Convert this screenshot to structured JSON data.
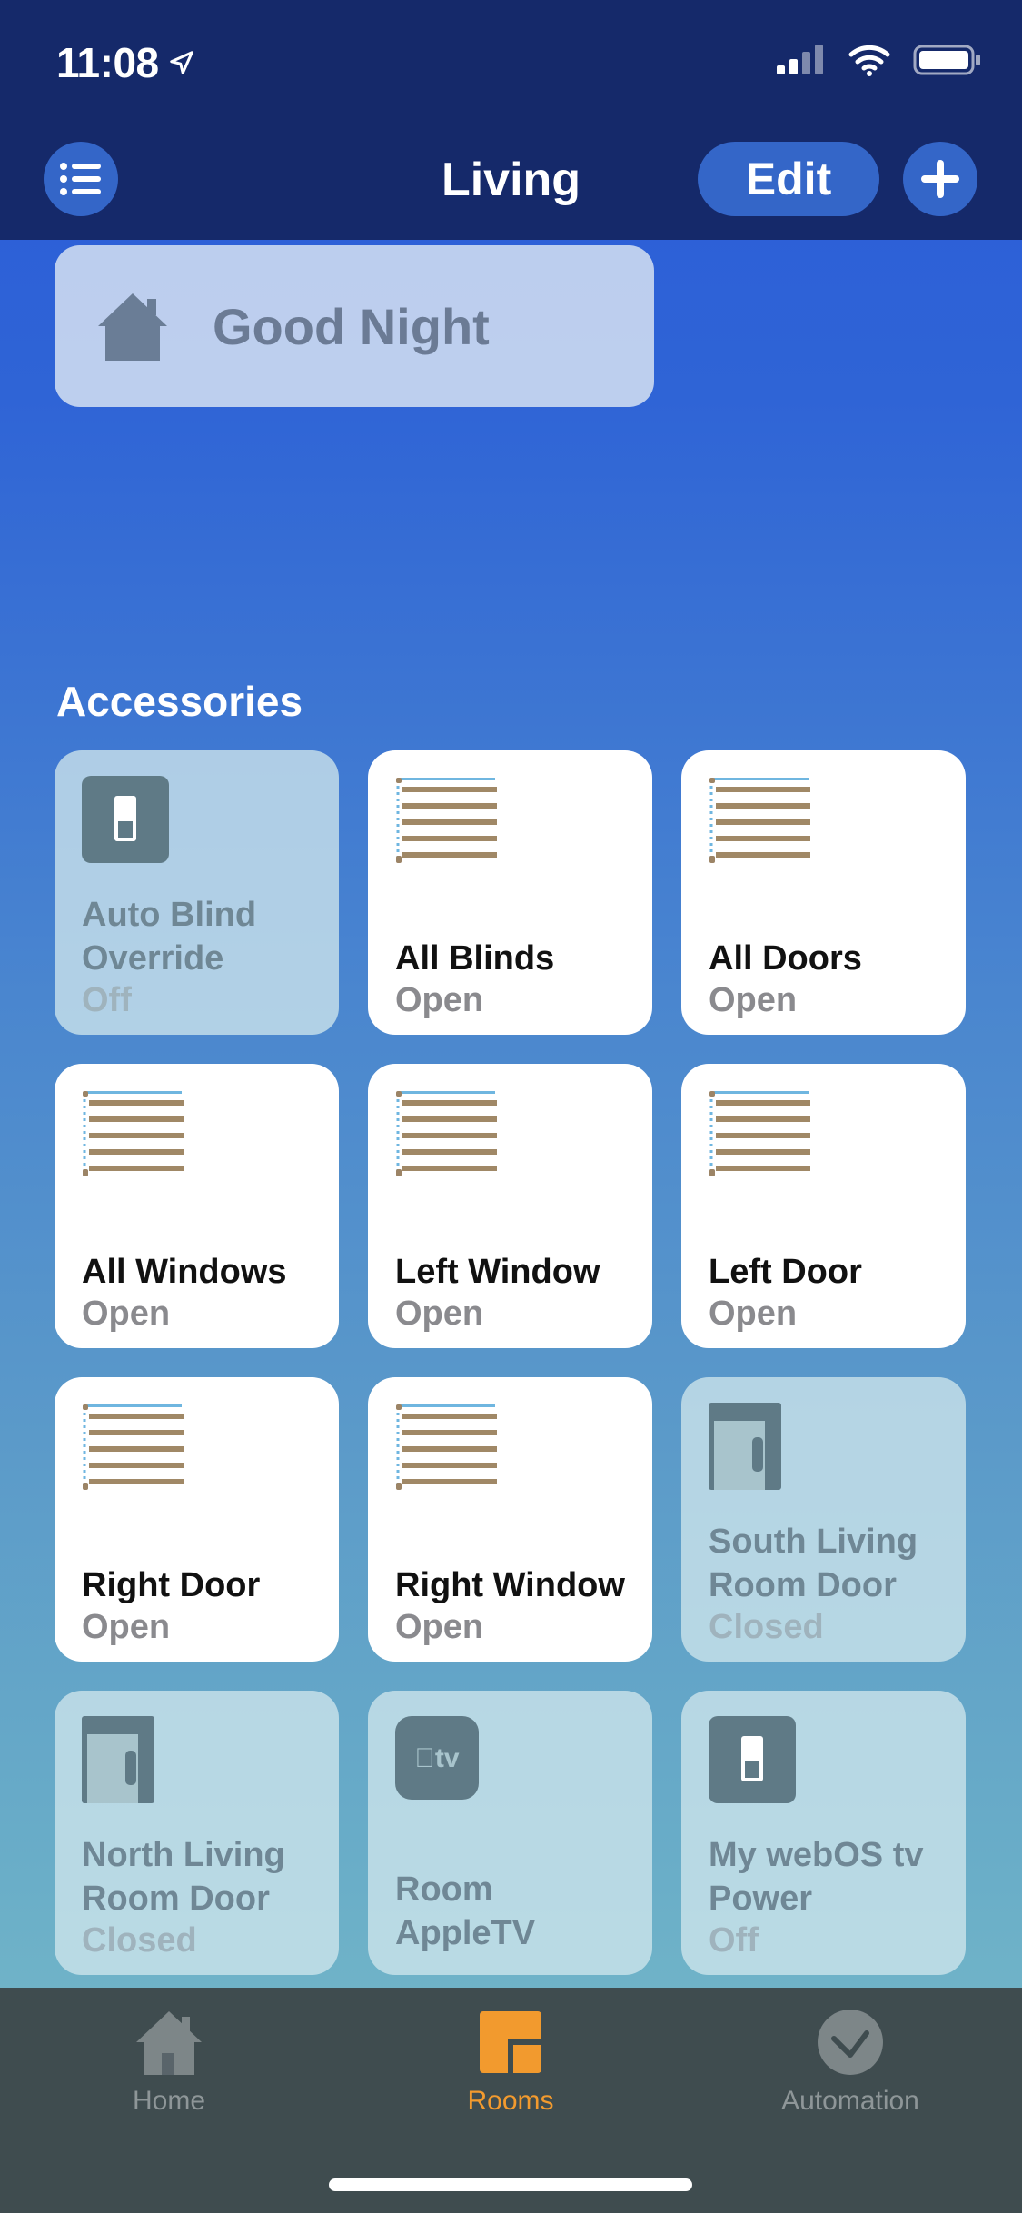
{
  "status": {
    "time": "11:08"
  },
  "nav": {
    "title": "Living",
    "edit_label": "Edit"
  },
  "scene": {
    "label": "Good Night",
    "icon": "house-icon"
  },
  "accessories": {
    "title": "Accessories",
    "tiles": [
      {
        "name": "Auto Blind Override",
        "state": "Off",
        "icon": "switch-icon",
        "active": false
      },
      {
        "name": "All Blinds",
        "state": "Open",
        "icon": "blinds-icon",
        "active": true
      },
      {
        "name": "All Doors",
        "state": "Open",
        "icon": "blinds-icon",
        "active": true
      },
      {
        "name": "All Windows",
        "state": "Open",
        "icon": "blinds-icon",
        "active": true
      },
      {
        "name": "Left Window",
        "state": "Open",
        "icon": "blinds-icon",
        "active": true
      },
      {
        "name": "Left Door",
        "state": "Open",
        "icon": "blinds-icon",
        "active": true
      },
      {
        "name": "Right Door",
        "state": "Open",
        "icon": "blinds-icon",
        "active": true
      },
      {
        "name": "Right Window",
        "state": "Open",
        "icon": "blinds-icon",
        "active": true
      },
      {
        "name": "South Living Room Door",
        "state": "Closed",
        "icon": "door-icon",
        "active": false
      },
      {
        "name": "North Living Room Door",
        "state": "Closed",
        "icon": "door-icon",
        "active": false
      },
      {
        "name": "Room AppleTV",
        "state": "",
        "icon": "appletv-icon",
        "active": false
      },
      {
        "name": "My webOS tv Power",
        "state": "Off",
        "icon": "switch-icon",
        "active": false
      }
    ]
  },
  "tabbar": {
    "items": [
      {
        "label": "Home",
        "active": false
      },
      {
        "label": "Rooms",
        "active": true
      },
      {
        "label": "Automation",
        "active": false
      }
    ]
  },
  "colors": {
    "accent": "#f29a2e",
    "header": "#15296a"
  }
}
